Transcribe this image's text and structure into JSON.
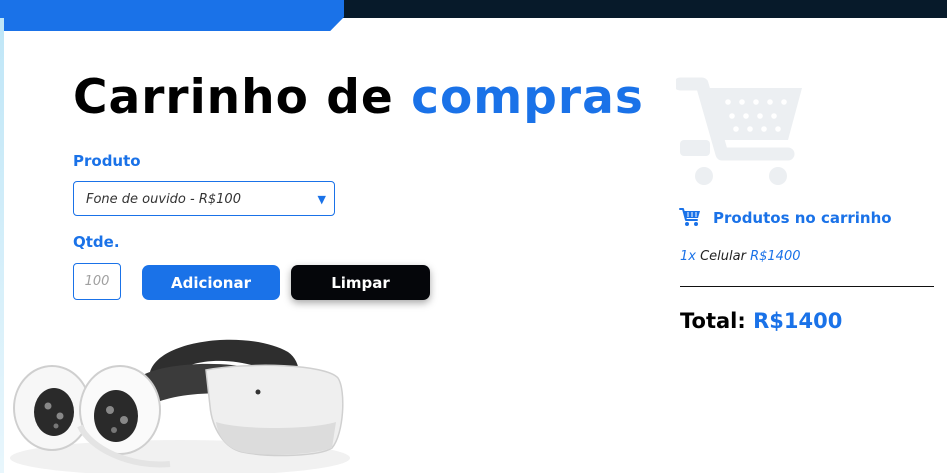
{
  "colors": {
    "accent": "#1a72e8",
    "dark": "#05060a",
    "topbar": "#071a2a"
  },
  "header": {
    "title_part1": "Carrinho de",
    "title_part2": "compras"
  },
  "form": {
    "product_label": "Produto",
    "product_selected": "Fone de ouvido - R$100",
    "qty_label": "Qtde.",
    "qty_placeholder": "100",
    "add_label": "Adicionar",
    "clear_label": "Limpar"
  },
  "cart": {
    "heading": "Produtos no carrinho",
    "items": [
      {
        "qty": "1x",
        "name": "Celular",
        "price": "R$1400"
      }
    ],
    "total_label": "Total:",
    "total_value": "R$1400"
  },
  "icons": {
    "dropdown": "chevron-down-icon",
    "cart_large": "shopping-cart-icon",
    "cart_small": "shopping-cart-icon"
  }
}
